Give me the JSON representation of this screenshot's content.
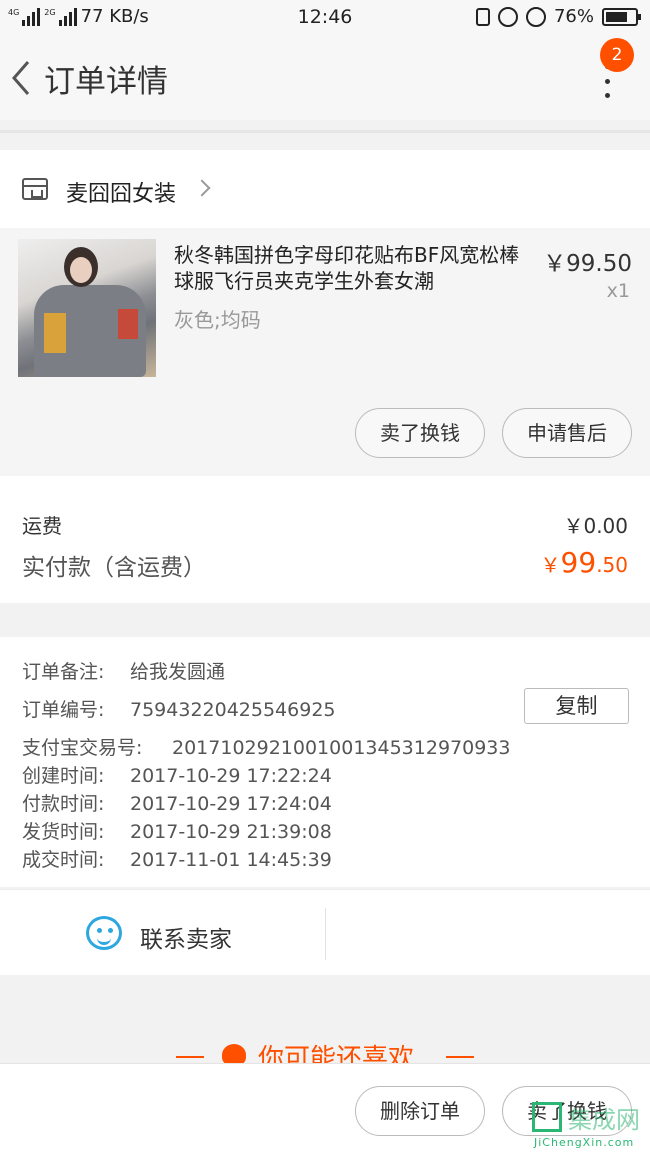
{
  "status_bar": {
    "net_type_1": "4G",
    "net_type_2": "2G",
    "speed": "77 KB/s",
    "time": "12:46",
    "battery": "76%",
    "battery_level": 0.76
  },
  "header": {
    "title": "订单详情",
    "notification_count": "2"
  },
  "shop": {
    "name": "麦囧囧女装"
  },
  "product": {
    "title": "秋冬韩国拼色字母印花贴布BF风宽松棒球服飞行员夹克学生外套女潮",
    "spec": "灰色;均码",
    "price": "￥99.50",
    "quantity": "x1",
    "actions": [
      "卖了换钱",
      "申请售后"
    ]
  },
  "fee": {
    "shipping_label": "运费",
    "shipping_value": "￥0.00",
    "total_label": "实付款（含运费）",
    "total_currency": "￥",
    "total_int": "99",
    "total_dec": ".50"
  },
  "info": {
    "rows": [
      {
        "key": "订单备注:",
        "value": "给我发圆通"
      },
      {
        "key": "订单编号:",
        "value": "75943220425546925"
      },
      {
        "key": "支付宝交易号:",
        "value": "2017102921001001345312970933"
      },
      {
        "key": "创建时间:",
        "value": "2017-10-29 17:22:24"
      },
      {
        "key": "付款时间:",
        "value": "2017-10-29 17:24:04"
      },
      {
        "key": "发货时间:",
        "value": "2017-10-29 21:39:08"
      },
      {
        "key": "成交时间:",
        "value": "2017-11-01 14:45:39"
      }
    ],
    "copy_label": "复制"
  },
  "contact": {
    "label": "联系卖家"
  },
  "recommend": {
    "title": "你可能还喜欢"
  },
  "bottom": {
    "actions": [
      "删除订单",
      "卖了换钱"
    ]
  },
  "watermark": {
    "text": "集成网",
    "sub": "JiChengXin.com"
  },
  "colors": {
    "accent": "#ff5000",
    "chat_blue": "#2da7e0"
  }
}
